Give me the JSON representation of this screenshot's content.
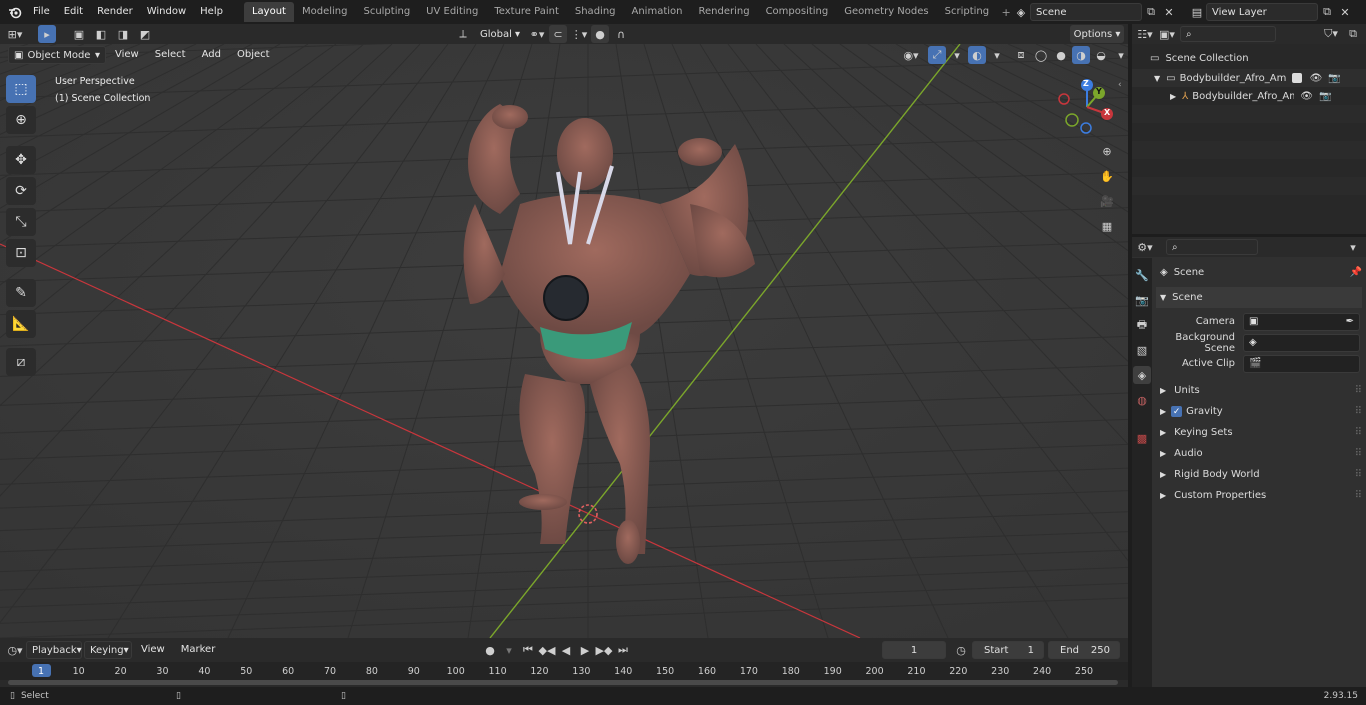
{
  "menu": [
    "File",
    "Edit",
    "Render",
    "Window",
    "Help"
  ],
  "workspaces": [
    "Layout",
    "Modeling",
    "Sculpting",
    "UV Editing",
    "Texture Paint",
    "Shading",
    "Animation",
    "Rendering",
    "Compositing",
    "Geometry Nodes",
    "Scripting"
  ],
  "active_workspace": "Layout",
  "scene_field": "Scene",
  "view_layer_field": "View Layer",
  "viewport": {
    "mode": "Object Mode",
    "menus": [
      "View",
      "Select",
      "Add",
      "Object"
    ],
    "transform_orientation": "Global",
    "options_label": "Options",
    "overlay_title": "User Perspective",
    "overlay_subtitle": "(1) Scene Collection",
    "gizmo_axes": [
      "Z",
      "Y",
      "X"
    ]
  },
  "outliner": {
    "root": "Scene Collection",
    "items": [
      "Bodybuilder_Afro_American_I",
      "Bodybuilder_Afro_Americ"
    ]
  },
  "properties": {
    "header": "Scene",
    "section": "Scene",
    "fields": [
      {
        "label": "Camera"
      },
      {
        "label": "Background Scene"
      },
      {
        "label": "Active Clip"
      }
    ],
    "panels": [
      "Units",
      "Gravity",
      "Keying Sets",
      "Audio",
      "Rigid Body World",
      "Custom Properties"
    ],
    "gravity_checked": true
  },
  "timeline": {
    "menus": [
      "Playback",
      "Keying",
      "View",
      "Marker"
    ],
    "current_frame": "1",
    "start_label": "Start",
    "start": "1",
    "end_label": "End",
    "end": "250",
    "ruler": [
      "1",
      "10",
      "20",
      "30",
      "40",
      "50",
      "60",
      "70",
      "80",
      "90",
      "100",
      "110",
      "120",
      "130",
      "140",
      "150",
      "160",
      "170",
      "180",
      "190",
      "200",
      "210",
      "220",
      "230",
      "240",
      "250"
    ]
  },
  "status": {
    "left": "Select",
    "version": "2.93.15"
  },
  "colors": {
    "accent": "#4772b3",
    "x_axis": "#c8363c",
    "y_axis": "#7ba62b",
    "z_axis": "#3c7de0"
  }
}
